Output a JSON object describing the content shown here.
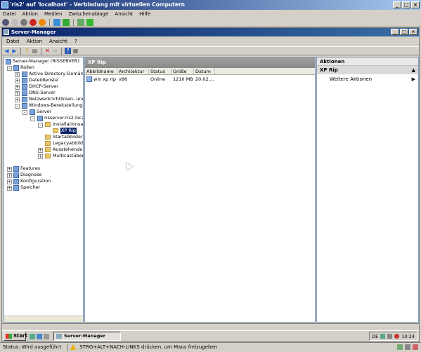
{
  "vm_window": {
    "title": "'ris2' auf 'localhost' - Verbindung mit virtuellen Computern",
    "menu": [
      "Datei",
      "Aktion",
      "Medien",
      "Zwischenablage",
      "Ansicht",
      "Hilfe"
    ],
    "status": "Status: Wird ausgeführt",
    "hint": "STRG+ALT+NACH-LINKS drücken, um Maus freizugeben"
  },
  "server_manager": {
    "title": "Server-Manager",
    "menu": [
      "Datei",
      "Aktion",
      "Ansicht",
      "?"
    ],
    "tree": [
      {
        "label": "Server-Manager (RISSERVER)",
        "level": 0
      },
      {
        "label": "Rollen",
        "level": 1
      },
      {
        "label": "Active Directory-Domänend",
        "level": 2
      },
      {
        "label": "Dateidienste",
        "level": 2
      },
      {
        "label": "DHCP-Server",
        "level": 2
      },
      {
        "label": "DNS-Server",
        "level": 2
      },
      {
        "label": "Netzwerkrichtlinien- und Zu",
        "level": 2
      },
      {
        "label": "Windows-Bereitstellungsdie",
        "level": 2
      },
      {
        "label": "Server",
        "level": 3
      },
      {
        "label": "risserver.ris2.local",
        "level": 4
      },
      {
        "label": "Installationsabb",
        "level": 5
      },
      {
        "label": "XP Rip",
        "level": 6
      },
      {
        "label": "Startabbilder",
        "level": 5
      },
      {
        "label": "Legacyabbilder",
        "level": 5
      },
      {
        "label": "Ausstehende G",
        "level": 5
      },
      {
        "label": "Multicastübertr",
        "level": 5
      },
      {
        "label": "Features",
        "level": 1
      },
      {
        "label": "Diagnose",
        "level": 1
      },
      {
        "label": "Konfiguration",
        "level": 1
      },
      {
        "label": "Speicher",
        "level": 1
      }
    ],
    "center": {
      "title": "XP Rip",
      "columns": [
        "Abbildname",
        "Architektur",
        "Status",
        "Größe",
        "Datum"
      ],
      "rows": [
        [
          "win xp rip",
          "x86",
          "Online",
          "1210 MB",
          "20.02...."
        ]
      ]
    },
    "actions": {
      "title": "Aktionen",
      "section": "XP Rip",
      "items": [
        "Weitere Aktionen"
      ]
    }
  },
  "taskbar": {
    "start": "Start",
    "task": "Server-Manager",
    "lang": "DE",
    "clock": "10:24"
  }
}
